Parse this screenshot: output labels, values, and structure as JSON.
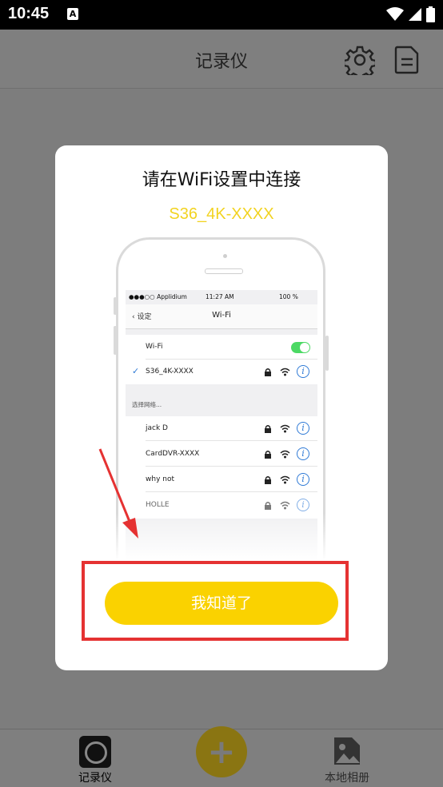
{
  "status_bar": {
    "time": "10:45",
    "notification_icon": "A"
  },
  "app_bar": {
    "title": "记录仪",
    "settings_icon": "gear-icon",
    "doc_icon": "document-icon"
  },
  "dialog": {
    "title": "请在WiFi设置中连接",
    "ssid": "S36_4K-XXXX",
    "button_label": "我知道了",
    "illustration": {
      "status_carrier": "●●●○○ Applidium",
      "status_time": "11:27 AM",
      "status_battery": "100 %",
      "back_label": "设定",
      "nav_title": "Wi-Fi",
      "wifi_label": "Wi-Fi",
      "connected_network": "S36_4K-XXXX",
      "section_label": "选择网络...",
      "networks": [
        "jack D",
        "CardDVR-XXXX",
        "why not",
        "HOLLE"
      ]
    }
  },
  "tabbar": {
    "recorder_label": "记录仪",
    "add_symbol": "+",
    "album_label": "本地相册"
  },
  "colors": {
    "accent": "#fad200",
    "ssid": "#f2d321",
    "highlight": "#e53232",
    "ios_blue": "#2f7ad6",
    "toggle_on": "#4cd964"
  }
}
